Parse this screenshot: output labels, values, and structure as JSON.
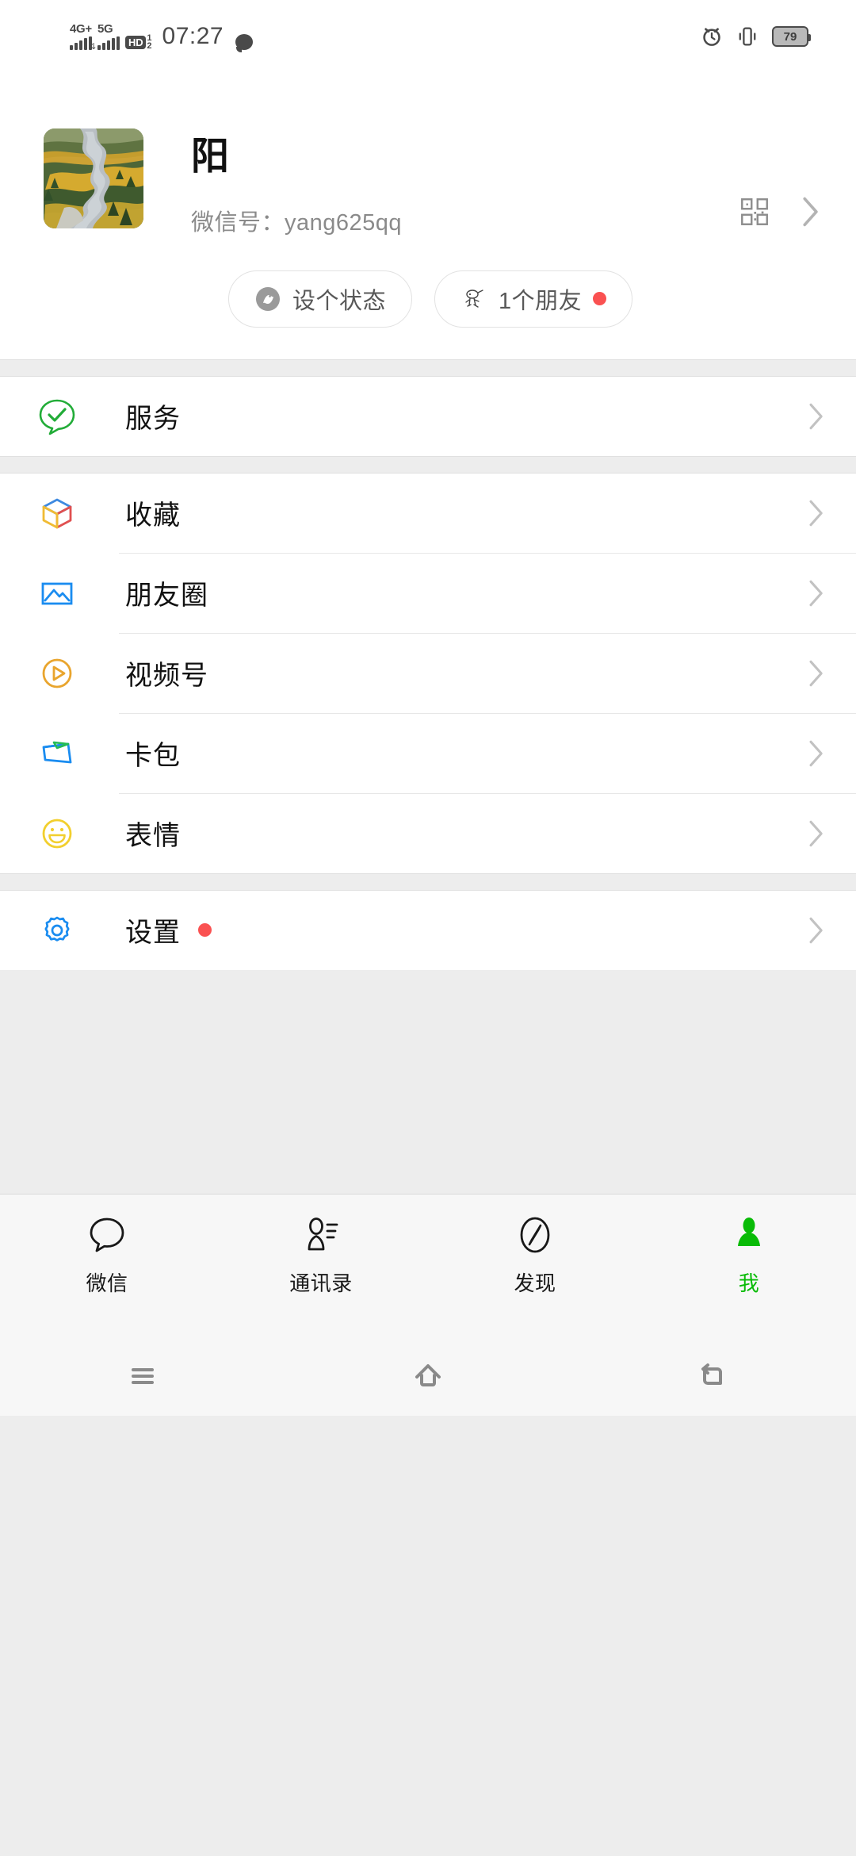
{
  "statusbar": {
    "net1_label": "4G+",
    "net2_label": "5G",
    "hd_label": "HD",
    "hd_sub_top": "1",
    "hd_sub_bottom": "2",
    "time": "07:27",
    "battery_level": "79",
    "icons": [
      "signal-4g-plus-icon",
      "signal-5g-icon",
      "hd-volte-icon",
      "message-bubble-icon",
      "alarm-clock-icon",
      "vibrate-icon",
      "battery-icon"
    ]
  },
  "profile": {
    "nickname": "阳",
    "wxid_label": "微信号：",
    "wxid_value": "yang625qq",
    "wxid_full": "微信号：yang625qq",
    "qr_icon": "qr-code-icon",
    "chevron_icon": "chevron-right-icon",
    "chips": [
      {
        "label": "设个状态",
        "icon": "status-face-icon",
        "badge": false
      },
      {
        "label": "1个朋友",
        "icon": "friend-doodle-icon",
        "badge": true
      }
    ]
  },
  "groups": [
    {
      "rows": [
        {
          "label": "服务",
          "icon": "services-icon",
          "badge": false
        }
      ]
    },
    {
      "rows": [
        {
          "label": "收藏",
          "icon": "favorites-cube-icon",
          "badge": false
        },
        {
          "label": "朋友圈",
          "icon": "moments-photo-icon",
          "badge": false
        },
        {
          "label": "视频号",
          "icon": "channels-play-icon",
          "badge": false
        },
        {
          "label": "卡包",
          "icon": "cards-wallet-icon",
          "badge": false
        },
        {
          "label": "表情",
          "icon": "stickers-smiley-icon",
          "badge": false
        }
      ]
    },
    {
      "rows": [
        {
          "label": "设置",
          "icon": "settings-gear-icon",
          "badge": true
        }
      ]
    }
  ],
  "tabbar": {
    "tabs": [
      {
        "label": "微信",
        "icon": "chat-bubble-icon",
        "active": false
      },
      {
        "label": "通讯录",
        "icon": "contacts-icon",
        "active": false
      },
      {
        "label": "发现",
        "icon": "discover-compass-icon",
        "active": false
      },
      {
        "label": "我",
        "icon": "me-person-icon",
        "active": true
      }
    ]
  },
  "navbar": {
    "buttons": [
      {
        "icon": "recents-menu-icon"
      },
      {
        "icon": "home-icon"
      },
      {
        "icon": "back-icon"
      }
    ]
  },
  "colors": {
    "accent_green": "#09bb07",
    "badge_red": "#fa5151",
    "page_bg": "#ededed",
    "card_bg": "#ffffff",
    "text_primary": "#111111",
    "text_secondary": "#8a8a8a"
  }
}
